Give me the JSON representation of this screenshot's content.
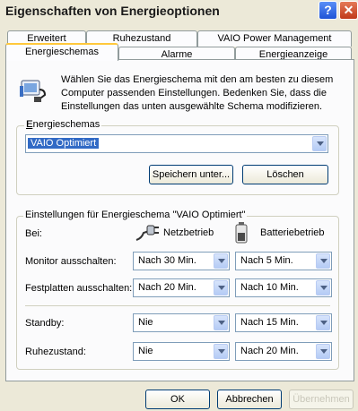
{
  "window": {
    "title": "Eigenschaften von Energieoptionen"
  },
  "tabs_row1": [
    {
      "label": "Erweitert"
    },
    {
      "label": "Ruhezustand"
    },
    {
      "label": "VAIO Power Management"
    }
  ],
  "tabs_row2": [
    {
      "label": "Energieschemas"
    },
    {
      "label": "Alarme"
    },
    {
      "label": "Energieanzeige"
    }
  ],
  "info": {
    "text": "Wählen Sie das Energieschema mit den am besten zu diesem Computer passenden Einstellungen. Bedenken Sie, dass die Einstellungen das unten ausgewählte Schema modifizieren."
  },
  "schemes": {
    "group_label": "Energieschemas",
    "selected": "VAIO Optimiert",
    "save_label": "Speichern unter...",
    "delete_label": "Löschen"
  },
  "settings": {
    "group_label": "Einstellungen für Energieschema \"VAIO Optimiert\"",
    "bei_label": "Bei:",
    "col_ac": "Netzbetrieb",
    "col_battery": "Batteriebetrieb",
    "rows": [
      {
        "label": "Monitor ausschalten:",
        "ac": "Nach 30 Min.",
        "battery": "Nach 5 Min."
      },
      {
        "label": "Festplatten ausschalten:",
        "ac": "Nach 20 Min.",
        "battery": "Nach 10 Min."
      },
      {
        "label": "Standby:",
        "ac": "Nie",
        "battery": "Nach 15 Min."
      },
      {
        "label": "Ruhezustand:",
        "ac": "Nie",
        "battery": "Nach 20 Min."
      }
    ]
  },
  "footer": {
    "ok": "OK",
    "cancel": "Abbrechen",
    "apply": "Übernehmen"
  }
}
